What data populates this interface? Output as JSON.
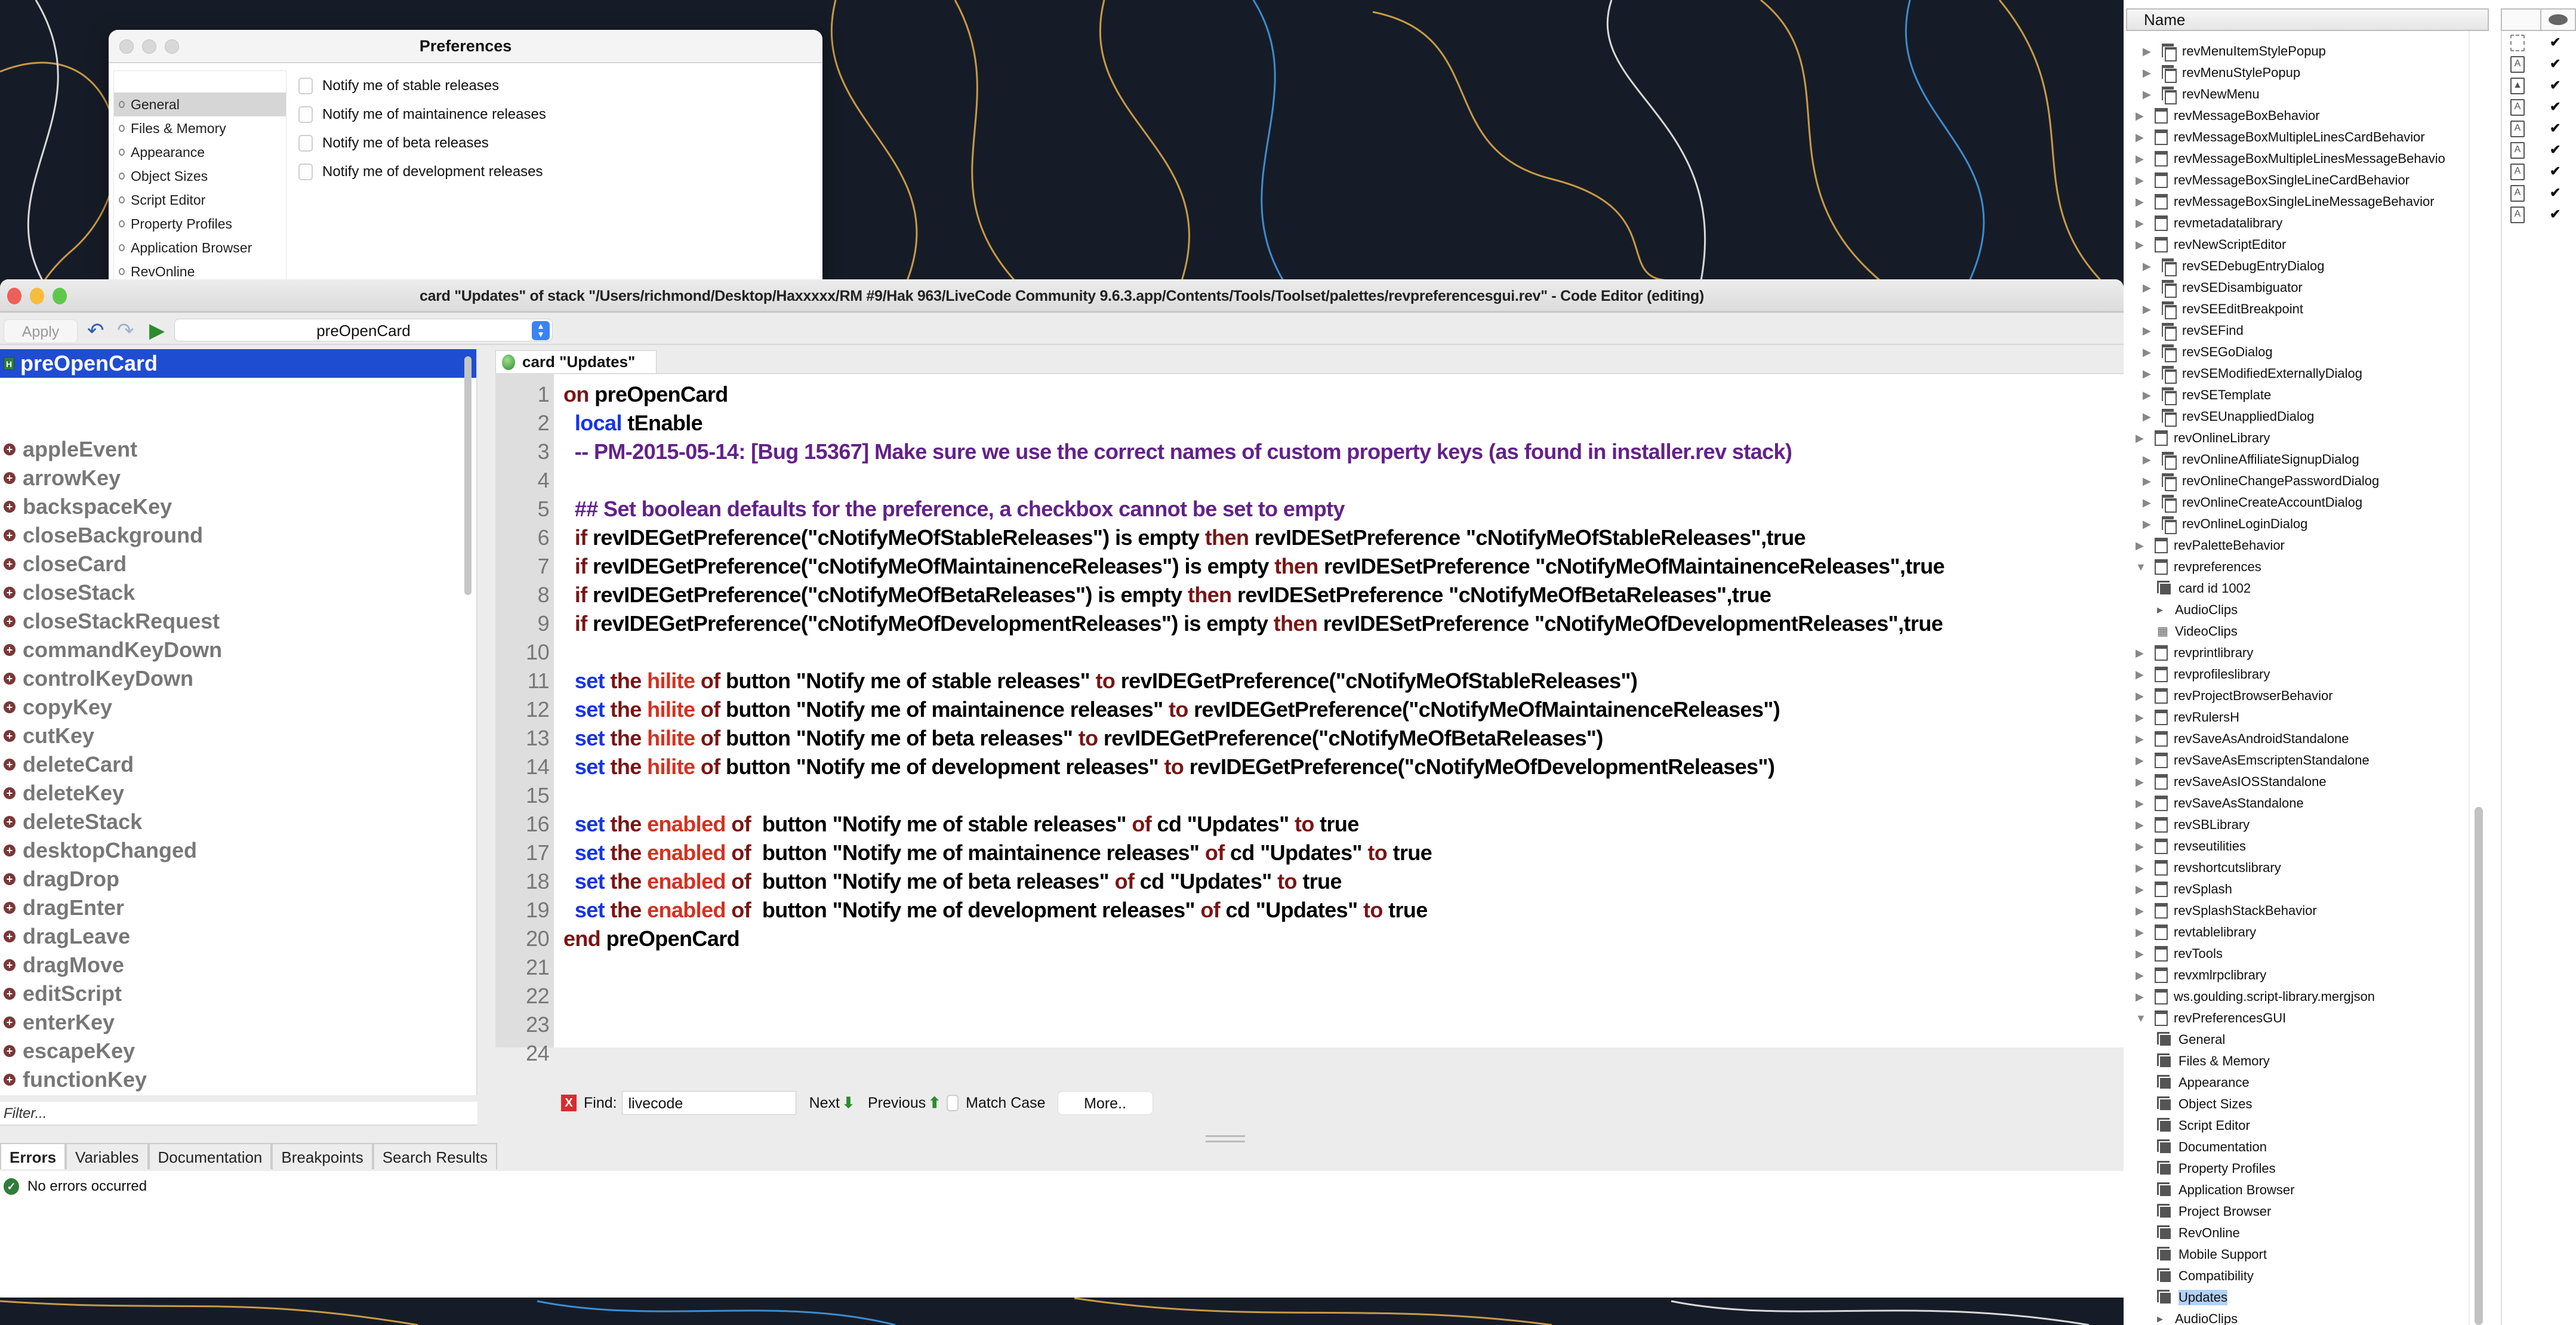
{
  "preferences_window": {
    "title": "Preferences",
    "nav": [
      "General",
      "Files & Memory",
      "Appearance",
      "Object Sizes",
      "Script Editor",
      "Property Profiles",
      "Application Browser",
      "RevOnline"
    ],
    "selected_nav": "General",
    "options": [
      {
        "label": "Notify me of stable releases",
        "checked": false
      },
      {
        "label": "Notify me of maintainence releases",
        "checked": false
      },
      {
        "label": "Notify me of beta releases",
        "checked": false
      },
      {
        "label": "Notify me of development releases",
        "checked": false
      }
    ]
  },
  "editor": {
    "title": "card \"Updates\" of stack \"/Users/richmond/Desktop/Haxxxxx/RM #9/Hak 963/LiveCode Community 9.6.3.app/Contents/Tools/Toolset/palettes/revpreferencesgui.rev\" - Code Editor (editing)",
    "toolbar": {
      "apply_label": "Apply",
      "handler_select": "preOpenCard"
    },
    "selected_handler": "preOpenCard",
    "handlers": [
      "appleEvent",
      "arrowKey",
      "backspaceKey",
      "closeBackground",
      "closeCard",
      "closeStack",
      "closeStackRequest",
      "commandKeyDown",
      "controlKeyDown",
      "copyKey",
      "cutKey",
      "deleteCard",
      "deleteKey",
      "deleteStack",
      "desktopChanged",
      "dragDrop",
      "dragEnter",
      "dragLeave",
      "dragMove",
      "editScript",
      "enterKey",
      "escapeKey",
      "functionKey"
    ],
    "filter_placeholder": "Filter...",
    "code_tab": "card \"Updates\"",
    "code_lines": [
      [
        [
          "kw",
          "on"
        ],
        [
          "plain",
          " preOpenCard"
        ]
      ],
      [
        [
          "plain",
          "  "
        ],
        [
          "blue",
          "local"
        ],
        [
          "plain",
          " tEnable"
        ]
      ],
      [
        [
          "cmt",
          "  -- PM-2015-05-14: [Bug 15367] Make sure we use the correct names of custom property keys (as found in installer.rev stack)"
        ]
      ],
      [],
      [
        [
          "cmt",
          "  ## Set boolean defaults for the preference, a checkbox cannot be set to empty"
        ]
      ],
      [
        [
          "plain",
          "  "
        ],
        [
          "kw",
          "if"
        ],
        [
          "plain",
          " revIDEGetPreference(\"cNotifyMeOfStableReleases\") is empty "
        ],
        [
          "kw",
          "then"
        ],
        [
          "plain",
          " revIDESetPreference \"cNotifyMeOfStableReleases\",true"
        ]
      ],
      [
        [
          "plain",
          "  "
        ],
        [
          "kw",
          "if"
        ],
        [
          "plain",
          " revIDEGetPreference(\"cNotifyMeOfMaintainenceReleases\") is empty "
        ],
        [
          "kw",
          "then"
        ],
        [
          "plain",
          " revIDESetPreference \"cNotifyMeOfMaintainenceReleases\",true"
        ]
      ],
      [
        [
          "plain",
          "  "
        ],
        [
          "kw",
          "if"
        ],
        [
          "plain",
          " revIDEGetPreference(\"cNotifyMeOfBetaReleases\") is empty "
        ],
        [
          "kw",
          "then"
        ],
        [
          "plain",
          " revIDESetPreference \"cNotifyMeOfBetaReleases\",true"
        ]
      ],
      [
        [
          "plain",
          "  "
        ],
        [
          "kw",
          "if"
        ],
        [
          "plain",
          " revIDEGetPreference(\"cNotifyMeOfDevelopmentReleases\") is empty "
        ],
        [
          "kw",
          "then"
        ],
        [
          "plain",
          " revIDESetPreference \"cNotifyMeOfDevelopmentReleases\",true"
        ]
      ],
      [],
      [
        [
          "plain",
          "  "
        ],
        [
          "blue",
          "set"
        ],
        [
          "kw",
          " the "
        ],
        [
          "red",
          "hilite"
        ],
        [
          "kw",
          " of"
        ],
        [
          "plain",
          " button \"Notify me of stable releases\" "
        ],
        [
          "kw",
          "to"
        ],
        [
          "plain",
          " revIDEGetPreference(\"cNotifyMeOfStableReleases\")"
        ]
      ],
      [
        [
          "plain",
          "  "
        ],
        [
          "blue",
          "set"
        ],
        [
          "kw",
          " the "
        ],
        [
          "red",
          "hilite"
        ],
        [
          "kw",
          " of"
        ],
        [
          "plain",
          " button \"Notify me of maintainence releases\" "
        ],
        [
          "kw",
          "to"
        ],
        [
          "plain",
          " revIDEGetPreference(\"cNotifyMeOfMaintainenceReleases\")"
        ]
      ],
      [
        [
          "plain",
          "  "
        ],
        [
          "blue",
          "set"
        ],
        [
          "kw",
          " the "
        ],
        [
          "red",
          "hilite"
        ],
        [
          "kw",
          " of"
        ],
        [
          "plain",
          " button \"Notify me of beta releases\" "
        ],
        [
          "kw",
          "to"
        ],
        [
          "plain",
          " revIDEGetPreference(\"cNotifyMeOfBetaReleases\")"
        ]
      ],
      [
        [
          "plain",
          "  "
        ],
        [
          "blue",
          "set"
        ],
        [
          "kw",
          " the "
        ],
        [
          "red",
          "hilite"
        ],
        [
          "kw",
          " of"
        ],
        [
          "plain",
          " button \"Notify me of development releases\" "
        ],
        [
          "kw",
          "to"
        ],
        [
          "plain",
          " revIDEGetPreference(\"cNotifyMeOfDevelopmentReleases\")"
        ]
      ],
      [],
      [
        [
          "plain",
          "  "
        ],
        [
          "blue",
          "set"
        ],
        [
          "kw",
          " the "
        ],
        [
          "red",
          "enabled"
        ],
        [
          "kw",
          " of "
        ],
        [
          "plain",
          " button \"Notify me of stable releases\" "
        ],
        [
          "kw",
          "of"
        ],
        [
          "plain",
          " cd \"Updates\" "
        ],
        [
          "kw",
          "to"
        ],
        [
          "plain",
          " true"
        ]
      ],
      [
        [
          "plain",
          "  "
        ],
        [
          "blue",
          "set"
        ],
        [
          "kw",
          " the "
        ],
        [
          "red",
          "enabled"
        ],
        [
          "kw",
          " of "
        ],
        [
          "plain",
          " button \"Notify me of maintainence releases\" "
        ],
        [
          "kw",
          "of"
        ],
        [
          "plain",
          " cd \"Updates\" "
        ],
        [
          "kw",
          "to"
        ],
        [
          "plain",
          " true"
        ]
      ],
      [
        [
          "plain",
          "  "
        ],
        [
          "blue",
          "set"
        ],
        [
          "kw",
          " the "
        ],
        [
          "red",
          "enabled"
        ],
        [
          "kw",
          " of "
        ],
        [
          "plain",
          " button \"Notify me of beta releases\" "
        ],
        [
          "kw",
          "of"
        ],
        [
          "plain",
          " cd \"Updates\" "
        ],
        [
          "kw",
          "to"
        ],
        [
          "plain",
          " true"
        ]
      ],
      [
        [
          "plain",
          "  "
        ],
        [
          "blue",
          "set"
        ],
        [
          "kw",
          " the "
        ],
        [
          "red",
          "enabled"
        ],
        [
          "kw",
          " of "
        ],
        [
          "plain",
          " button \"Notify me of development releases\" "
        ],
        [
          "kw",
          "of"
        ],
        [
          "plain",
          " cd \"Updates\" "
        ],
        [
          "kw",
          "to"
        ],
        [
          "plain",
          " true"
        ]
      ],
      [
        [
          "kw",
          "end"
        ],
        [
          "plain",
          " preOpenCard"
        ]
      ],
      [],
      [],
      [],
      []
    ],
    "find": {
      "label": "Find:",
      "value": "livecode",
      "next": "Next",
      "previous": "Previous",
      "match_case": "Match Case",
      "match_case_checked": false,
      "more": "More.."
    },
    "bottom_tabs": [
      "Errors",
      "Variables",
      "Documentation",
      "Breakpoints",
      "Search Results"
    ],
    "active_bottom_tab": "Errors",
    "error_status": "No errors occurred"
  },
  "project_browser": {
    "column_header": "Name",
    "rows": [
      {
        "label": "revMenuItemStylePopup",
        "indent": 1,
        "type": "substack",
        "expand": "collapsed"
      },
      {
        "label": "revMenuStylePopup",
        "indent": 1,
        "type": "substack",
        "expand": "collapsed"
      },
      {
        "label": "revNewMenu",
        "indent": 1,
        "type": "substack",
        "expand": "collapsed"
      },
      {
        "label": "revMessageBoxBehavior",
        "indent": 0,
        "type": "stack",
        "expand": "collapsed"
      },
      {
        "label": "revMessageBoxMultipleLinesCardBehavior",
        "indent": 0,
        "type": "stack",
        "expand": "collapsed"
      },
      {
        "label": "revMessageBoxMultipleLinesMessageBehavio",
        "indent": 0,
        "type": "stack",
        "expand": "collapsed"
      },
      {
        "label": "revMessageBoxSingleLineCardBehavior",
        "indent": 0,
        "type": "stack",
        "expand": "collapsed"
      },
      {
        "label": "revMessageBoxSingleLineMessageBehavior",
        "indent": 0,
        "type": "stack",
        "expand": "collapsed"
      },
      {
        "label": "revmetadatalibrary",
        "indent": 0,
        "type": "stack",
        "expand": "collapsed"
      },
      {
        "label": "revNewScriptEditor",
        "indent": 0,
        "type": "stack",
        "expand": "collapsed"
      },
      {
        "label": "revSEDebugEntryDialog",
        "indent": 1,
        "type": "substack",
        "expand": "collapsed"
      },
      {
        "label": "revSEDisambiguator",
        "indent": 1,
        "type": "substack",
        "expand": "collapsed"
      },
      {
        "label": "revSEEditBreakpoint",
        "indent": 1,
        "type": "substack",
        "expand": "collapsed"
      },
      {
        "label": "revSEFind",
        "indent": 1,
        "type": "substack",
        "expand": "collapsed"
      },
      {
        "label": "revSEGoDialog",
        "indent": 1,
        "type": "substack",
        "expand": "collapsed"
      },
      {
        "label": "revSEModifiedExternallyDialog",
        "indent": 1,
        "type": "substack",
        "expand": "collapsed"
      },
      {
        "label": "revSETemplate",
        "indent": 1,
        "type": "substack",
        "expand": "collapsed"
      },
      {
        "label": "revSEUnappliedDialog",
        "indent": 1,
        "type": "substack",
        "expand": "collapsed"
      },
      {
        "label": "revOnlineLibrary",
        "indent": 0,
        "type": "stack",
        "expand": "collapsed"
      },
      {
        "label": "revOnlineAffiliateSignupDialog",
        "indent": 1,
        "type": "substack",
        "expand": "collapsed"
      },
      {
        "label": "revOnlineChangePasswordDialog",
        "indent": 1,
        "type": "substack",
        "expand": "collapsed"
      },
      {
        "label": "revOnlineCreateAccountDialog",
        "indent": 1,
        "type": "substack",
        "expand": "collapsed"
      },
      {
        "label": "revOnlineLoginDialog",
        "indent": 1,
        "type": "substack",
        "expand": "collapsed"
      },
      {
        "label": "revPaletteBehavior",
        "indent": 0,
        "type": "stack",
        "expand": "collapsed"
      },
      {
        "label": "revpreferences",
        "indent": 0,
        "type": "stack",
        "expand": "expanded"
      },
      {
        "label": "card id 1002",
        "indent": 2,
        "type": "card",
        "expand": "none"
      },
      {
        "label": "AudioClips",
        "indent": 2,
        "type": "audio",
        "expand": "none"
      },
      {
        "label": "VideoClips",
        "indent": 2,
        "type": "video",
        "expand": "none"
      },
      {
        "label": "revprintlibrary",
        "indent": 0,
        "type": "stack",
        "expand": "collapsed"
      },
      {
        "label": "revprofileslibrary",
        "indent": 0,
        "type": "stack",
        "expand": "collapsed"
      },
      {
        "label": "revProjectBrowserBehavior",
        "indent": 0,
        "type": "stack",
        "expand": "collapsed"
      },
      {
        "label": "revRulersH",
        "indent": 0,
        "type": "stack",
        "expand": "collapsed"
      },
      {
        "label": "revSaveAsAndroidStandalone",
        "indent": 0,
        "type": "stack",
        "expand": "collapsed"
      },
      {
        "label": "revSaveAsEmscriptenStandalone",
        "indent": 0,
        "type": "stack",
        "expand": "collapsed"
      },
      {
        "label": "revSaveAsIOSStandalone",
        "indent": 0,
        "type": "stack",
        "expand": "collapsed"
      },
      {
        "label": "revSaveAsStandalone",
        "indent": 0,
        "type": "stack",
        "expand": "collapsed"
      },
      {
        "label": "revSBLibrary",
        "indent": 0,
        "type": "stack",
        "expand": "collapsed"
      },
      {
        "label": "revseutilities",
        "indent": 0,
        "type": "stack",
        "expand": "collapsed"
      },
      {
        "label": "revshortcutslibrary",
        "indent": 0,
        "type": "stack",
        "expand": "collapsed"
      },
      {
        "label": "revSplash",
        "indent": 0,
        "type": "stack",
        "expand": "collapsed"
      },
      {
        "label": "revSplashStackBehavior",
        "indent": 0,
        "type": "stack",
        "expand": "collapsed"
      },
      {
        "label": "revtablelibrary",
        "indent": 0,
        "type": "stack",
        "expand": "collapsed"
      },
      {
        "label": "revTools",
        "indent": 0,
        "type": "stack",
        "expand": "collapsed"
      },
      {
        "label": "revxmlrpclibrary",
        "indent": 0,
        "type": "stack",
        "expand": "collapsed"
      },
      {
        "label": "ws.goulding.script-library.mergjson",
        "indent": 0,
        "type": "stack",
        "expand": "collapsed"
      },
      {
        "label": "revPreferencesGUI",
        "indent": 0,
        "type": "stack",
        "expand": "expanded"
      },
      {
        "label": "General",
        "indent": 2,
        "type": "card",
        "expand": "none"
      },
      {
        "label": "Files & Memory",
        "indent": 2,
        "type": "card",
        "expand": "none"
      },
      {
        "label": "Appearance",
        "indent": 2,
        "type": "card",
        "expand": "none"
      },
      {
        "label": "Object Sizes",
        "indent": 2,
        "type": "card",
        "expand": "none"
      },
      {
        "label": "Script Editor",
        "indent": 2,
        "type": "card",
        "expand": "none"
      },
      {
        "label": "Documentation",
        "indent": 2,
        "type": "card",
        "expand": "none"
      },
      {
        "label": "Property Profiles",
        "indent": 2,
        "type": "card",
        "expand": "none"
      },
      {
        "label": "Application Browser",
        "indent": 2,
        "type": "card",
        "expand": "none"
      },
      {
        "label": "Project Browser",
        "indent": 2,
        "type": "card",
        "expand": "none"
      },
      {
        "label": "RevOnline",
        "indent": 2,
        "type": "card",
        "expand": "none"
      },
      {
        "label": "Mobile Support",
        "indent": 2,
        "type": "card",
        "expand": "none"
      },
      {
        "label": "Compatibility",
        "indent": 2,
        "type": "card",
        "expand": "none"
      },
      {
        "label": "Updates",
        "indent": 2,
        "type": "card",
        "expand": "none",
        "selected": true
      },
      {
        "label": "AudioClips",
        "indent": 2,
        "type": "audio",
        "expand": "none"
      }
    ],
    "property_rows": [
      {
        "icon": "selection-icon",
        "visible": true
      },
      {
        "icon": "field-icon",
        "visible": true
      },
      {
        "icon": "image-icon",
        "visible": true
      },
      {
        "icon": "text-icon",
        "visible": true
      },
      {
        "icon": "field-icon",
        "visible": true
      },
      {
        "icon": "field-icon",
        "visible": true
      },
      {
        "icon": "field-icon",
        "visible": true
      },
      {
        "icon": "field-icon",
        "visible": true
      },
      {
        "icon": "field-icon",
        "visible": true
      }
    ]
  }
}
